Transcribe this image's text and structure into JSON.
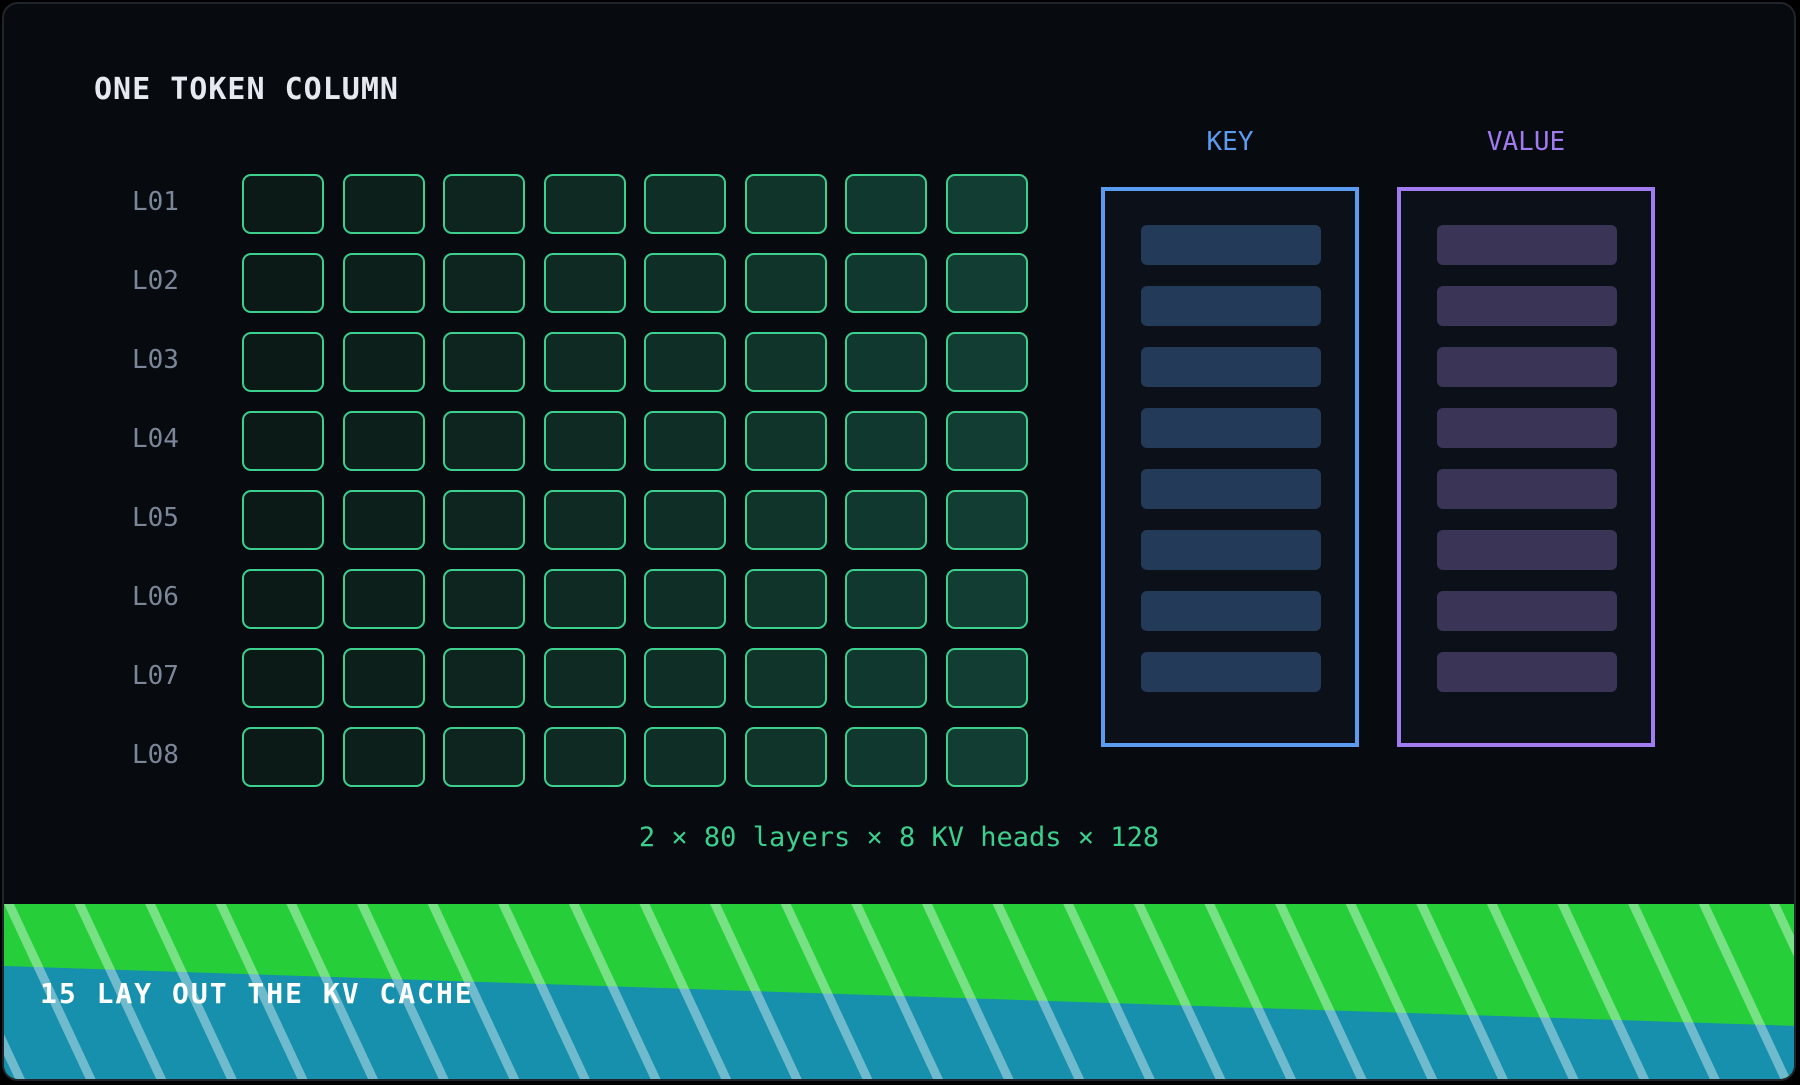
{
  "title": "ONE TOKEN COLUMN",
  "layers": [
    "L01",
    "L02",
    "L03",
    "L04",
    "L05",
    "L06",
    "L07",
    "L08"
  ],
  "heads_per_layer": 8,
  "formula": "2 × 80 layers × 8 KV heads × 128",
  "key_panel": {
    "label": "KEY",
    "color": "#5b9bf0",
    "slot_color": "#233b59",
    "slots": 8
  },
  "value_panel": {
    "label": "VALUE",
    "color": "#a07cf0",
    "slot_color": "#3a3457",
    "slots": 8
  },
  "banner": {
    "label": "15 LAY OUT THE KV CACHE",
    "top_color": "#26cf3a",
    "bottom_color": "#1690ac"
  },
  "colors": {
    "cell_border": "#3ccf8e",
    "cell_fill_start": "#0c1a17",
    "cell_fill_end": "#123d32"
  }
}
